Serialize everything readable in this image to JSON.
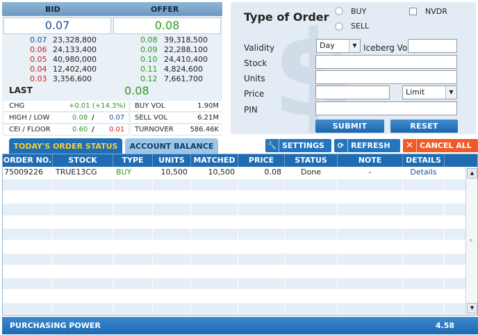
{
  "market": {
    "bid_label": "BID",
    "offer_label": "OFFER",
    "best_bid": "0.07",
    "best_offer": "0.08",
    "depth": [
      {
        "bid": "0.07",
        "bid_vol": "23,328,800",
        "offer": "0.08",
        "offer_vol": "39,318,500"
      },
      {
        "bid": "0.06",
        "bid_vol": "24,133,400",
        "offer": "0.09",
        "offer_vol": "22,288,100"
      },
      {
        "bid": "0.05",
        "bid_vol": "40,980,000",
        "offer": "0.10",
        "offer_vol": "24,410,400"
      },
      {
        "bid": "0.04",
        "bid_vol": "12,402,400",
        "offer": "0.11",
        "offer_vol": "4,824,600"
      },
      {
        "bid": "0.03",
        "bid_vol": "3,356,600",
        "offer": "0.12",
        "offer_vol": "7,661,700"
      }
    ],
    "last_label": "LAST",
    "last_value": "0.08",
    "stats": {
      "chg_label": "CHG",
      "chg_value": "+0.01 (+14.3%)",
      "high_low_label": "HIGH / LOW",
      "high": "0.08",
      "low": "0.07",
      "separator": "/",
      "ceil_floor_label": "CEI / FLOOR",
      "ceil": "0.60",
      "floor": "0.01",
      "buy_vol_label": "BUY VOL",
      "buy_vol": "1.90M",
      "sell_vol_label": "SELL VOL",
      "sell_vol": "6.21M",
      "turnover_label": "TURNOVER",
      "turnover": "586.46K"
    }
  },
  "order_form": {
    "title": "Type of Order",
    "buy_label": "BUY",
    "sell_label": "SELL",
    "nvdr_label": "NVDR",
    "validity_label": "Validity",
    "validity_value": "Day",
    "iceberg_label": "Iceberg Vol",
    "stock_label": "Stock",
    "units_label": "Units",
    "price_label": "Price",
    "price_type_value": "Limit",
    "pin_label": "PIN",
    "submit_label": "SUBMIT",
    "reset_label": "RESET"
  },
  "tabs": {
    "order_status": "TODAY'S ORDER STATUS",
    "account_balance": "ACCOUNT BALANCE"
  },
  "toolbar": {
    "settings": "SETTINGS",
    "refresh": "REFRESH",
    "cancel_all": "CANCEL ALL"
  },
  "grid": {
    "columns": [
      "ORDER NO.",
      "STOCK",
      "TYPE",
      "UNITS",
      "MATCHED",
      "PRICE",
      "STATUS",
      "NOTE",
      "DETAILS"
    ],
    "rows": [
      {
        "order_no": "75009226",
        "stock": "TRUE13CG",
        "type": "BUY",
        "units": "10,500",
        "matched": "10,500",
        "price": "0.08",
        "status": "Done",
        "note": "-",
        "details": "Details"
      }
    ]
  },
  "footer": {
    "purchasing_power_label": "PURCHASING POWER",
    "purchasing_power_value": "4.58"
  },
  "colors": {
    "header_blue": "#1f6cb2",
    "cancel_orange": "#f05a28",
    "up_green": "#2a9a1d",
    "down_red": "#d31d1d",
    "tab_active_text": "#ffcc33"
  }
}
